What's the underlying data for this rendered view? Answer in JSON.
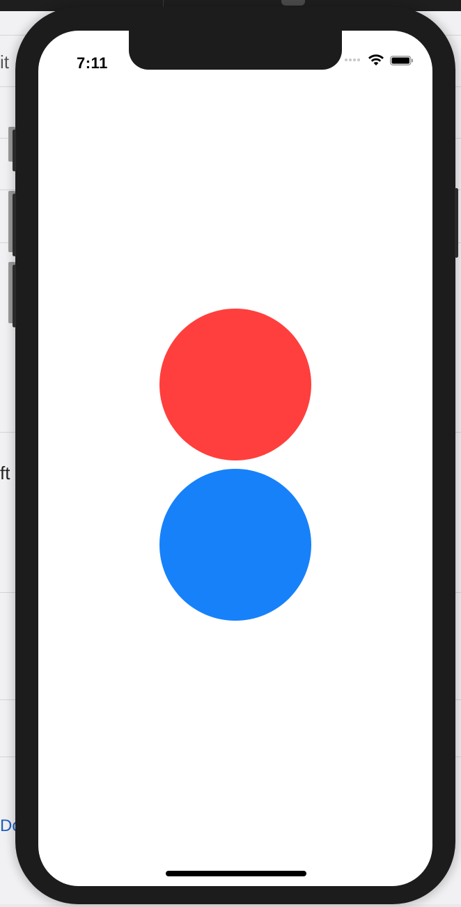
{
  "status_bar": {
    "time": "7:11",
    "wifi_icon": "wifi-icon",
    "battery_icon": "battery-icon",
    "signal_icon": "cellular-dots-icon"
  },
  "canvas": {
    "circles": [
      {
        "name": "red-circle",
        "color": "#ff3f3d"
      },
      {
        "name": "blue-circle",
        "color": "#1781fa"
      }
    ]
  },
  "background_doc": {
    "fragment_top": "it",
    "fragment_mid": "ft",
    "fragment_link": "Do"
  }
}
